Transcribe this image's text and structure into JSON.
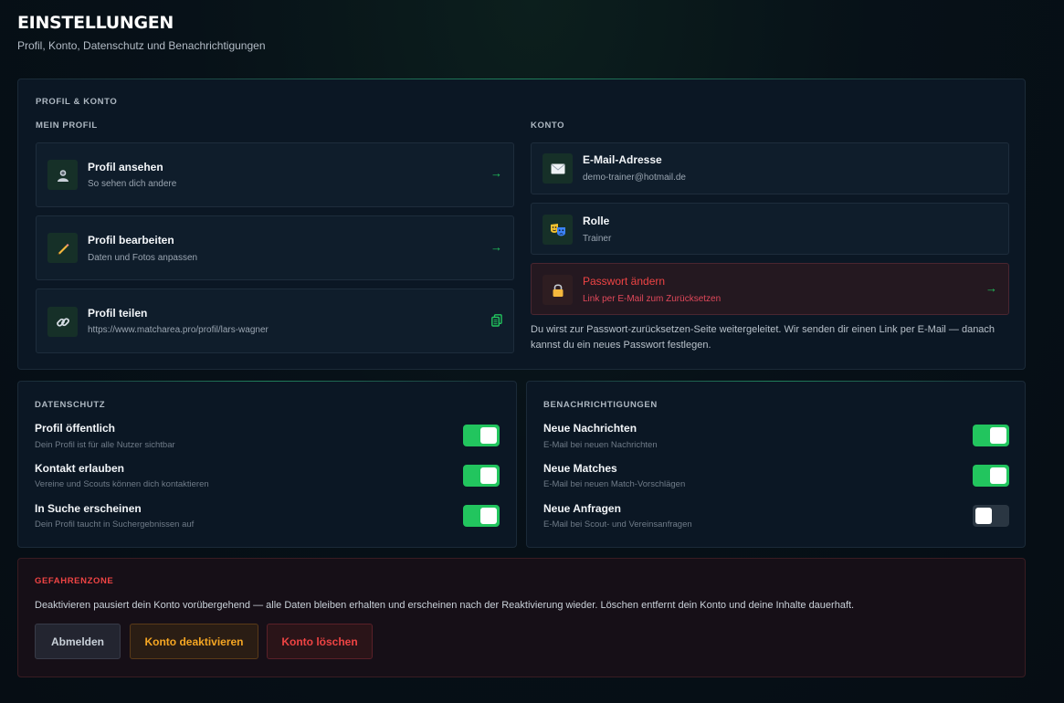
{
  "header": {
    "title": "EINSTELLUNGEN",
    "subtitle": "Profil, Konto, Datenschutz und Benachrichtigungen"
  },
  "profile_account": {
    "section_label": "PROFIL & KONTO",
    "my_profile": {
      "label": "MEIN PROFIL",
      "items": [
        {
          "title": "Profil ansehen",
          "subtitle": "So sehen dich andere",
          "icon": "user-bust-icon",
          "action": "→"
        },
        {
          "title": "Profil bearbeiten",
          "subtitle": "Daten und Fotos anpassen",
          "icon": "pencil-icon",
          "action": "→"
        },
        {
          "title": "Profil teilen",
          "subtitle": "https://www.matcharea.pro/profil/lars-wagner",
          "icon": "link-icon",
          "action": "copy-icon"
        }
      ]
    },
    "account": {
      "label": "KONTO",
      "items": [
        {
          "title": "E-Mail-Adresse",
          "subtitle": "demo-trainer@hotmail.de",
          "icon": "envelope-icon"
        },
        {
          "title": "Rolle",
          "subtitle": "Trainer",
          "icon": "theater-masks-icon"
        },
        {
          "title": "Passwort ändern",
          "subtitle": "Link per E-Mail zum Zurücksetzen",
          "icon": "lock-icon",
          "action": "→"
        }
      ],
      "note": "Du wirst zur Passwort-zurücksetzen-Seite weitergeleitet. Wir senden dir einen Link per E-Mail — danach kannst du ein neues Passwort festlegen."
    }
  },
  "privacy": {
    "section_label": "DATENSCHUTZ",
    "items": [
      {
        "title": "Profil öffentlich",
        "subtitle": "Dein Profil ist für alle Nutzer sichtbar",
        "enabled": true
      },
      {
        "title": "Kontakt erlauben",
        "subtitle": "Vereine und Scouts können dich kontaktieren",
        "enabled": true
      },
      {
        "title": "In Suche erscheinen",
        "subtitle": "Dein Profil taucht in Suchergebnissen auf",
        "enabled": true
      }
    ]
  },
  "notifications": {
    "section_label": "BENACHRICHTIGUNGEN",
    "items": [
      {
        "title": "Neue Nachrichten",
        "subtitle": "E-Mail bei neuen Nachrichten",
        "enabled": true
      },
      {
        "title": "Neue Matches",
        "subtitle": "E-Mail bei neuen Match-Vorschlägen",
        "enabled": true
      },
      {
        "title": "Neue Anfragen",
        "subtitle": "E-Mail bei Scout- und Vereinsanfragen",
        "enabled": false
      }
    ]
  },
  "danger_zone": {
    "section_label": "GEFAHRENZONE",
    "text": "Deaktivieren pausiert dein Konto vorübergehend — alle Daten bleiben erhalten und erscheinen nach der Reaktivierung wieder. Löschen entfernt dein Konto und deine Inhalte dauerhaft.",
    "buttons": {
      "logout": "Abmelden",
      "deactivate": "Konto deaktivieren",
      "delete": "Konto löschen"
    }
  },
  "colors": {
    "accent": "#22c55e",
    "danger": "#ef4444",
    "warning": "#f5a623"
  }
}
